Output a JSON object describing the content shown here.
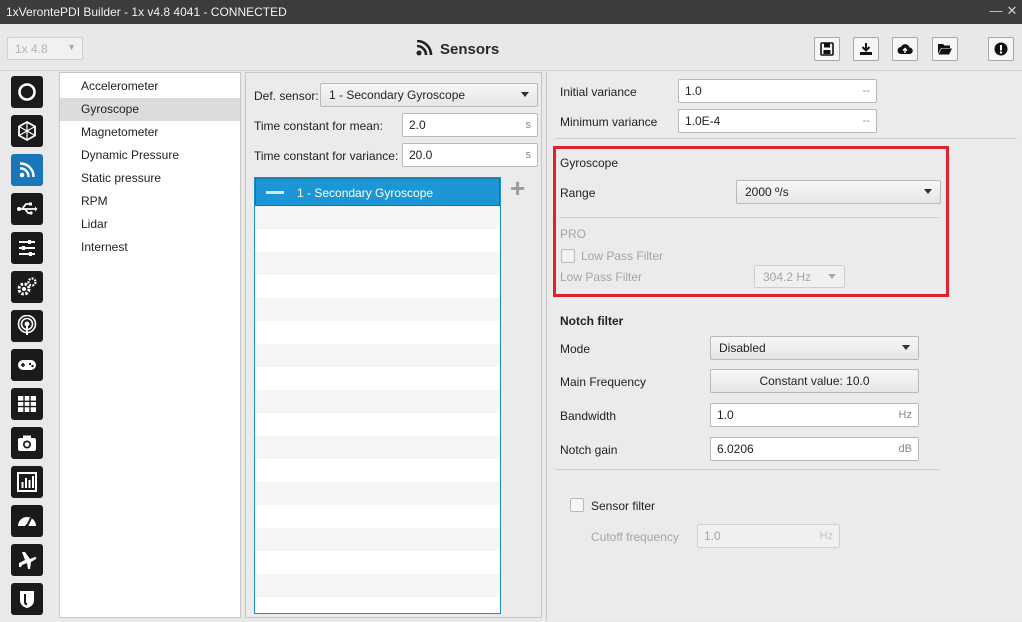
{
  "window": {
    "title": "1xVerontePDI Builder - 1x v4.8 4041 - CONNECTED",
    "controls": [
      "minimize-icon",
      "maximize-icon",
      "close-icon"
    ]
  },
  "header": {
    "version_select": "1x 4.8",
    "page_title": "Sensors",
    "page_icon": "rss-icon",
    "toolbar": [
      "save-icon",
      "download-icon",
      "cloud-upload-icon",
      "folder-open-icon",
      "alert-icon"
    ]
  },
  "rail": {
    "items": [
      "power-icon",
      "hexagon-icon",
      "sensors-icon",
      "usb-icon",
      "sliders-icon",
      "gears-icon",
      "broadcast-icon",
      "gamepad-icon",
      "grid-icon",
      "camera-icon",
      "chart-icon",
      "gauge-icon",
      "airplane-icon",
      "shield-icon"
    ],
    "active": "sensors-icon",
    "accent": "#1976b8"
  },
  "menu": {
    "items": [
      "Accelerometer",
      "Gyroscope",
      "Magnetometer",
      "Dynamic Pressure",
      "Static pressure",
      "RPM",
      "Lidar",
      "Internest"
    ],
    "selected": "Gyroscope"
  },
  "middle": {
    "def_sensor_label": "Def. sensor:",
    "def_sensor_value": "1 - Secondary Gyroscope",
    "tc_mean_label": "Time constant for mean:",
    "tc_mean_value": "2.0",
    "tc_mean_unit": "s",
    "tc_var_label": "Time constant for variance:",
    "tc_var_value": "20.0",
    "tc_var_unit": "s",
    "list_items": [
      "1 - Secondary Gyroscope"
    ]
  },
  "right": {
    "initial_variance_label": "Initial variance",
    "initial_variance_value": "1.0",
    "initial_variance_unit": "--",
    "min_variance_label": "Minimum variance",
    "min_variance_value": "1.0E-4",
    "min_variance_unit": "--",
    "gyro_section": "Gyroscope",
    "range_label": "Range",
    "range_value": "2000 º/s",
    "pro_label": "PRO",
    "lpf_checkbox_label": "Low Pass Filter",
    "lpf_label": "Low Pass Filter",
    "lpf_value": "304.2 Hz",
    "notch_title": "Notch filter",
    "mode_label": "Mode",
    "mode_value": "Disabled",
    "main_freq_label": "Main Frequency",
    "main_freq_value": "Constant value: 10.0",
    "bandwidth_label": "Bandwidth",
    "bandwidth_value": "1.0",
    "bandwidth_unit": "Hz",
    "notch_gain_label": "Notch gain",
    "notch_gain_value": "6.0206",
    "notch_gain_unit": "dB",
    "sensor_filter_label": "Sensor filter",
    "cutoff_label": "Cutoff frequency",
    "cutoff_value": "1.0",
    "cutoff_unit": "Hz",
    "highlight_color": "#e2202a"
  }
}
